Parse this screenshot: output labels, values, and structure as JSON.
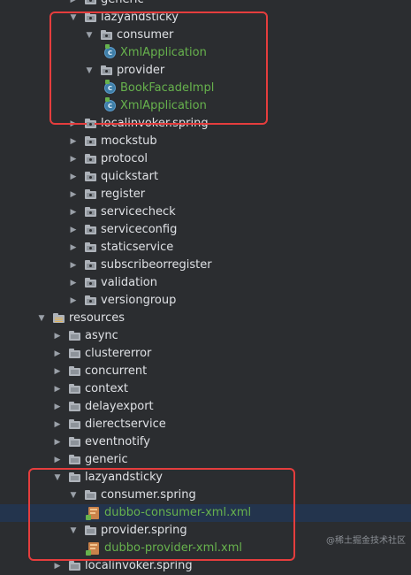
{
  "tree": [
    {
      "type": "package",
      "label": "generic",
      "indent": 1,
      "expanded": false,
      "partial": true
    },
    {
      "type": "package",
      "label": "lazyandsticky",
      "indent": 1,
      "expanded": true
    },
    {
      "type": "package",
      "label": "consumer",
      "indent": 2,
      "expanded": true
    },
    {
      "type": "class",
      "label": "XmlApplication",
      "indent": 3
    },
    {
      "type": "package",
      "label": "provider",
      "indent": 2,
      "expanded": true
    },
    {
      "type": "class",
      "label": "BookFacadeImpl",
      "indent": 3
    },
    {
      "type": "class",
      "label": "XmlApplication",
      "indent": 3
    },
    {
      "type": "package",
      "label": "localinvoker.spring",
      "indent": 1,
      "expanded": false
    },
    {
      "type": "package",
      "label": "mockstub",
      "indent": 1,
      "expanded": false
    },
    {
      "type": "package",
      "label": "protocol",
      "indent": 1,
      "expanded": false
    },
    {
      "type": "package",
      "label": "quickstart",
      "indent": 1,
      "expanded": false
    },
    {
      "type": "package",
      "label": "register",
      "indent": 1,
      "expanded": false
    },
    {
      "type": "package",
      "label": "servicecheck",
      "indent": 1,
      "expanded": false
    },
    {
      "type": "package",
      "label": "serviceconfig",
      "indent": 1,
      "expanded": false
    },
    {
      "type": "package",
      "label": "staticservice",
      "indent": 1,
      "expanded": false
    },
    {
      "type": "package",
      "label": "subscribeorregister",
      "indent": 1,
      "expanded": false
    },
    {
      "type": "package",
      "label": "validation",
      "indent": 1,
      "expanded": false
    },
    {
      "type": "package",
      "label": "versiongroup",
      "indent": 1,
      "expanded": false
    },
    {
      "type": "resources",
      "label": "resources",
      "indent": 0,
      "expanded": true
    },
    {
      "type": "folder",
      "label": "async",
      "indent": 1,
      "expanded": false
    },
    {
      "type": "folder",
      "label": "clustererror",
      "indent": 1,
      "expanded": false
    },
    {
      "type": "folder",
      "label": "concurrent",
      "indent": 1,
      "expanded": false
    },
    {
      "type": "folder",
      "label": "context",
      "indent": 1,
      "expanded": false
    },
    {
      "type": "folder",
      "label": "delayexport",
      "indent": 1,
      "expanded": false
    },
    {
      "type": "folder",
      "label": "dierectservice",
      "indent": 1,
      "expanded": false
    },
    {
      "type": "folder",
      "label": "eventnotify",
      "indent": 1,
      "expanded": false
    },
    {
      "type": "folder",
      "label": "generic",
      "indent": 1,
      "expanded": false
    },
    {
      "type": "folder",
      "label": "lazyandsticky",
      "indent": 1,
      "expanded": true
    },
    {
      "type": "folder",
      "label": "consumer.spring",
      "indent": 2,
      "expanded": true
    },
    {
      "type": "xml",
      "label": "dubbo-consumer-xml.xml",
      "indent": 3,
      "selected": true
    },
    {
      "type": "folder",
      "label": "provider.spring",
      "indent": 2,
      "expanded": true
    },
    {
      "type": "xml",
      "label": "dubbo-provider-xml.xml",
      "indent": 3
    },
    {
      "type": "folder",
      "label": "localinvoker.spring",
      "indent": 1,
      "expanded": false,
      "partial": true
    }
  ],
  "watermark": "@稀土掘金技术社区",
  "colors": {
    "background": "#2b2d30",
    "highlight": "#e53d3d",
    "green_text": "#67b24d",
    "selection": "#23344d"
  }
}
